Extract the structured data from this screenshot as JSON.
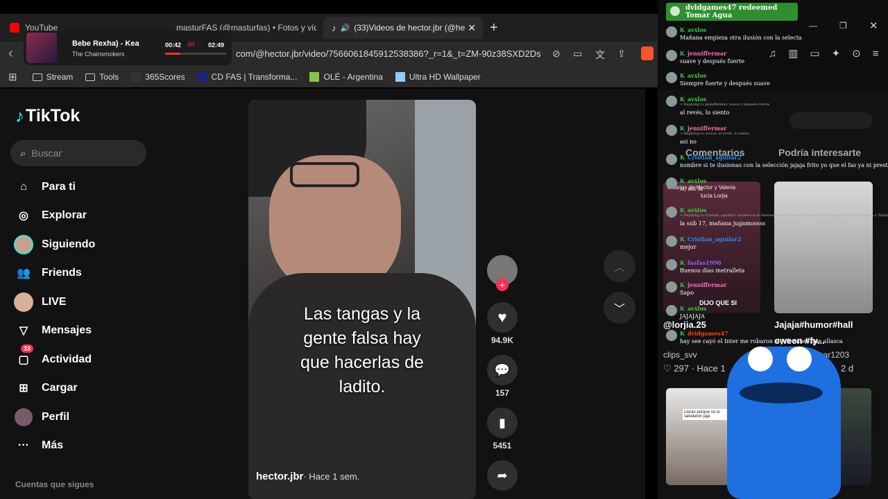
{
  "tabs": [
    {
      "label": "YouTube",
      "icon": "youtube-icon"
    },
    {
      "label": "masturFAS (@masturfas) • Fotos y víd",
      "icon": "instagram-icon"
    },
    {
      "label": "(33)Videos de hector.jbr (@he",
      "icon": "tiktok-icon"
    }
  ],
  "media": {
    "title": "Bebe Rexha) - Kea",
    "artist": "The Chainsmokers",
    "time_current": "00:42",
    "time_total": "02:49"
  },
  "url": "com/@hector.jbr/video/7566061845912538386?_r=1&_t=ZM-90z38SXD2Ds",
  "bookmarks": [
    "Stream",
    "Tools",
    "365Scores",
    "CD FAS | Transforma...",
    "OLÉ - Argentina",
    "Ultra HD Wallpaper"
  ],
  "tiktok": {
    "logo": "TikTok",
    "search_placeholder": "Buscar",
    "nav": [
      "Para ti",
      "Explorar",
      "Siguiendo",
      "Friends",
      "LIVE",
      "Mensajes",
      "Actividad",
      "Cargar",
      "Perfil",
      "Más"
    ],
    "activity_badge": "33",
    "footer_label": "Cuentas que sigues",
    "video": {
      "caption_lines": [
        "Las tangas y la",
        "gente falsa hay",
        "que hacerlas de",
        "ladito."
      ],
      "author": "hector.jbr",
      "time": "· Hace 1 sem."
    },
    "actions": {
      "likes": "94.9K",
      "comments": "157",
      "saves": "5451"
    },
    "side_tabs": [
      "Comentarios",
      "Podría interesarte"
    ],
    "related": [
      {
        "user": "@lorjia.25",
        "caption": "clips_svv",
        "stats": "297 · Hace 1",
        "overlay": "entarios de Hector y Valeria",
        "overlay2": "lucía Lorjia",
        "overlay3": "DIJO QUE SI"
      },
      {
        "user": "Jajaja#humor#hall",
        "caption": "oween #fy...",
        "stats": "azar1203",
        "date": "2 d"
      }
    ],
    "related_bottom_text": "Lloran porque no lo saludaron jaja"
  },
  "chat": {
    "banner": "dvidgames47 redeemed Tomar Agua",
    "messages": [
      {
        "user": "avxlos",
        "text": "Mañana empieza otra ilusión con la selecta",
        "color": "#3ad23a"
      },
      {
        "user": "jenniffermar",
        "text": "suave y después fuerte",
        "color": "#ff69b4"
      },
      {
        "user": "avxlos",
        "text": "Siempre fuerte y después suave",
        "color": "#3ad23a"
      },
      {
        "user": "avxlos",
        "text": "al revés, lo siento",
        "reply": "Replying to jenniffermar: suave y después fuerte",
        "color": "#3ad23a"
      },
      {
        "user": "jenniffermar",
        "text": "asi no",
        "reply": "Replying to avxlos: al revés, lo siento",
        "color": "#ff69b4"
      },
      {
        "user": "Cristian_aguilar2",
        "text": "nombre si te ilusionas con la selección jajaja frito yo que el fas ya ni prestara a Tejada",
        "color": "#1e90ff"
      },
      {
        "user": "avxlos",
        "text": "si, así la",
        "color": "#3ad23a"
      },
      {
        "user": "avxlos",
        "text": "la sub 17, mañana jugamossss",
        "reply": "Replying to Cristian_aguilar2: nombre si te ilusionas con la selección jajaja frito yo que el fas ya ni prestara a Tejada",
        "color": "#3ad23a"
      },
      {
        "user": "Cristian_aguilar2",
        "text": "mejor",
        "color": "#1e90ff"
      },
      {
        "user": "fasfas1990",
        "text": "Buenos días metralleta",
        "color": "#9b59ff"
      },
      {
        "user": "jenniffermar",
        "text": "Sapo",
        "color": "#ff69b4"
      },
      {
        "user": "avxlos",
        "text": "JAJAJAJA",
        "color": "#3ad23a"
      },
      {
        "user": "dvidgames47",
        "text": "hay see cayó el Inter me robaron al jefe sabes que allasca",
        "color": "#ff4500"
      }
    ]
  },
  "colors": {
    "accent": "#fe2c55",
    "bg": "#121212"
  }
}
